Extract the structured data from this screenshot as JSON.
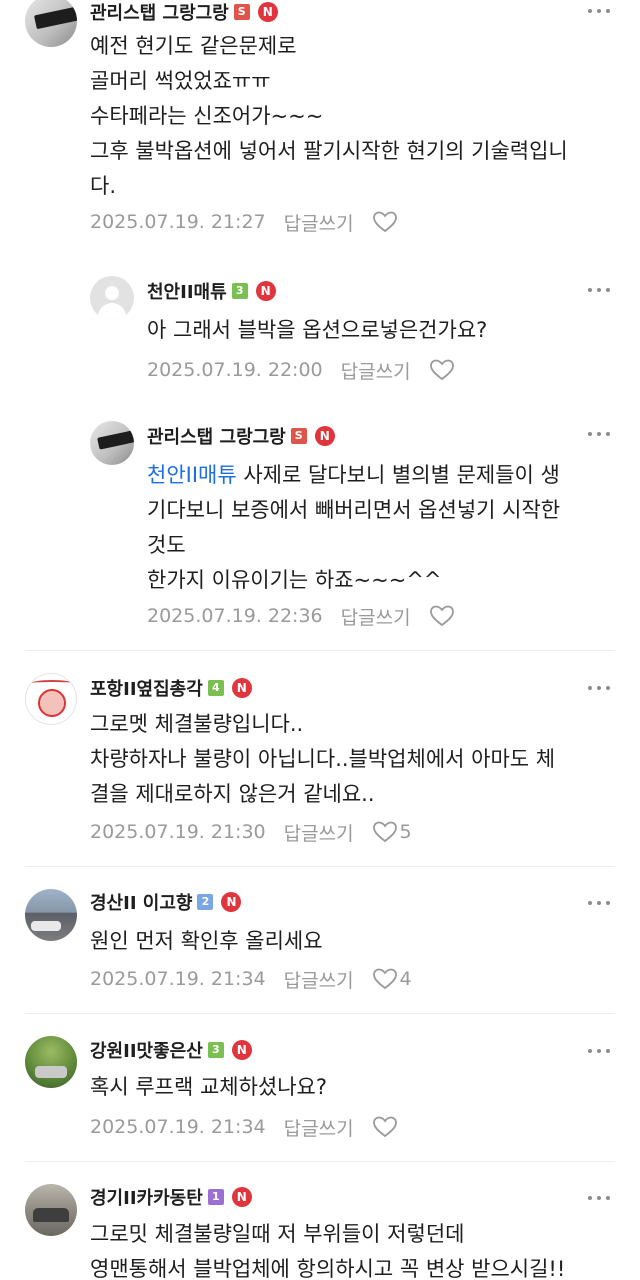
{
  "comments": [
    {
      "nickname": "관리스탭 그랑그랑",
      "level_badge": "S",
      "n_badge": "N",
      "lines": [
        "예전 현기도 같은문제로",
        "골머리 썩었었죠ㅠㅠ",
        "수타페라는 신조어가~~~",
        "그후 불박옵션에 넣어서 팔기시작한 현기의 기술력입니",
        "다."
      ],
      "date": "2025.07.19. 21:27",
      "reply_label": "답글쓰기",
      "likes": ""
    },
    {
      "nickname": "천안II매튜",
      "level_badge": "3",
      "n_badge": "N",
      "lines": [
        "아 그래서 블박을 옵션으로넣은건가요?"
      ],
      "date": "2025.07.19. 22:00",
      "reply_label": "답글쓰기",
      "likes": ""
    },
    {
      "nickname": "관리스탭 그랑그랑",
      "level_badge": "S",
      "n_badge": "N",
      "mention": "천안II매튜",
      "first_line_rest": " 사제로 달다보니 별의별 문제들이 생",
      "lines": [
        "기다보니 보증에서 빼버리면서 옵션넣기 시작한",
        "것도",
        "한가지 이유이기는 하죠~~~^^"
      ],
      "date": "2025.07.19. 22:36",
      "reply_label": "답글쓰기",
      "likes": ""
    },
    {
      "nickname": "포항II옆집총각",
      "level_badge": "4",
      "n_badge": "N",
      "lines": [
        "그로멧 체결불량입니다..",
        "차량하자나 불량이 아닙니다..블박업체에서 아마도 체",
        "결을 제대로하지 않은거 같네요.."
      ],
      "date": "2025.07.19. 21:30",
      "reply_label": "답글쓰기",
      "likes": "5"
    },
    {
      "nickname": "경산II 이고향",
      "level_badge": "2",
      "n_badge": "N",
      "lines": [
        "원인 먼저 확인후 올리세요"
      ],
      "date": "2025.07.19. 21:34",
      "reply_label": "답글쓰기",
      "likes": "4"
    },
    {
      "nickname": "강원II맛좋은산",
      "level_badge": "3",
      "n_badge": "N",
      "lines": [
        "혹시 루프랙 교체하셨나요?"
      ],
      "date": "2025.07.19. 21:34",
      "reply_label": "답글쓰기",
      "likes": ""
    },
    {
      "nickname": "경기II카카동탄",
      "level_badge": "1",
      "n_badge": "N",
      "lines": [
        "그로밋 체결불량일때 저 부위들이 저렇던데",
        "영맨통해서 블박업체에 항의하시고 꼭 변상 받으시길!!"
      ],
      "date": "",
      "reply_label": "",
      "likes": ""
    }
  ],
  "icons": {
    "more": "more-vertical-icon",
    "like": "heart-outline-icon"
  },
  "colors": {
    "mention": "#1f6fe0",
    "meta_text": "#9a9a9a",
    "n_badge": "#e0353d"
  }
}
